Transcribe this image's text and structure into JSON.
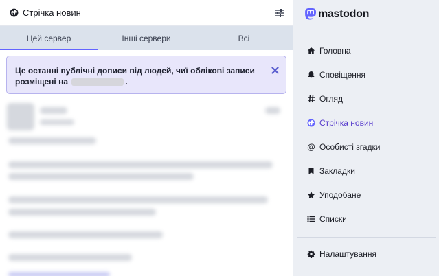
{
  "column": {
    "title": "Стрічка новин",
    "icons": {
      "globe": "globe-icon",
      "settings": "sliders-icon"
    }
  },
  "tabs": [
    {
      "label": "Цей сервер",
      "active": true
    },
    {
      "label": "Інші сервери",
      "active": false
    },
    {
      "label": "Всі",
      "active": false
    }
  ],
  "notice": {
    "text_before": "Це останні публічні дописи від людей, чиї облікові записи розміщені на",
    "text_after": ".",
    "close_icon": "close-icon"
  },
  "sidebar": {
    "logo_text": "mastodon",
    "items": [
      {
        "label": "Головна",
        "icon": "home-icon",
        "active": false
      },
      {
        "label": "Сповіщення",
        "icon": "bell-icon",
        "active": false
      },
      {
        "label": "Огляд",
        "icon": "hashtag-icon",
        "active": false
      },
      {
        "label": "Стрічка новин",
        "icon": "globe-icon",
        "active": true
      },
      {
        "label": "Особисті згадки",
        "icon": "at-icon",
        "active": false
      },
      {
        "label": "Закладки",
        "icon": "bookmark-icon",
        "active": false
      },
      {
        "label": "Уподобане",
        "icon": "star-icon",
        "active": false
      },
      {
        "label": "Списки",
        "icon": "list-icon",
        "active": false
      }
    ],
    "settings": {
      "label": "Налаштування",
      "icon": "gear-icon"
    }
  },
  "colors": {
    "accent": "#6364ff",
    "active_nav": "#563acc",
    "notice_bg": "#e8e6fb"
  }
}
